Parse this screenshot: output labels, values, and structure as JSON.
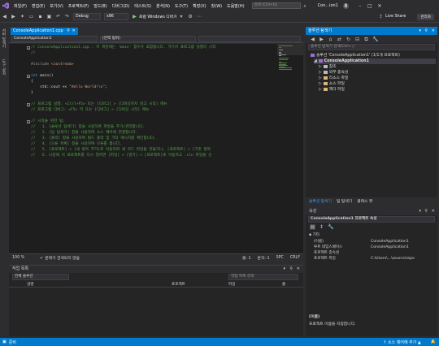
{
  "menu": {
    "items": [
      "파일(F)",
      "편집(E)",
      "보기(V)",
      "프로젝트(P)",
      "빌드(B)",
      "디버그(D)",
      "테스트(S)",
      "분석(N)",
      "도구(T)",
      "확장(X)",
      "창(W)",
      "도움말(H)"
    ],
    "search_placeholder": "검색 (Ctrl+Q)",
    "title_text": "Con...ion1",
    "user_initial": "8"
  },
  "toolbar": {
    "config": "Debug",
    "platform": "x86",
    "run_label": "로컬 Windows 디버거",
    "live_share": "Live Share",
    "admin": "관리자"
  },
  "left_strip": {
    "labels": [
      "서버 탐색기",
      "도구 상자"
    ]
  },
  "editor": {
    "tab_label": "ConsoleApplication1.cpp",
    "nav_project": "ConsoleApplication1",
    "nav_scope": "(전역 범위)",
    "lines": [
      "// ConsoleApplication1.cpp : 이 파일에는 'main' 함수가 포함됩니다. 거기서 프로그램 실행이 시작",
      "//",
      "",
      "#include <iostream>",
      "",
      "int main()",
      "{",
      "    std::cout << \"Hello World!\\n\";",
      "}",
      "",
      "// 프로그램 실행: <Ctrl+F5> 또는 [디버그] > [디버깅하지 않고 시작] 메뉴",
      "// 프로그램 디버그: <F5> 키 또는 [디버그] > [디버깅 시작] 메뉴",
      "",
      "// 시작을 위한 팁:",
      "//   1. [솔루션 탐색기] 창을 사용하여 파일을 추가/관리합니다.",
      "//   2. [팀 탐색기] 창을 사용하여 소스 제어에 연결합니다.",
      "//   3. [출력] 창을 사용하여 빌드 출력 및 기타 메시지를 확인합니다.",
      "//   4. [오류 목록] 창을 사용하여 오류를 봅니다.",
      "//   5. [프로젝트] > [새 항목 추가]로 이동하여 새 코드 파일을 만들거나, [프로젝트] > [기존 항목",
      "//   6. 나중에 이 프로젝트를 다시 열려면 [파일] > [열기] > [프로젝트]로 이동하고 .sln 파일을 선"
    ],
    "status_zoom": "100 %",
    "status_issues": "문제가 검색되지 않음",
    "status_line": "줄: 1",
    "status_col": "문자: 1",
    "status_mode": "SPC",
    "status_eol": "CRLF"
  },
  "error_list": {
    "title": "작업 목록",
    "scope": "전체 솔루션",
    "search_placeholder": "작업 목록 검색",
    "columns": [
      "설명",
      "프로젝트",
      "파일",
      "줄"
    ]
  },
  "solution_explorer": {
    "title": "솔루션 탐색기",
    "search_placeholder": "솔루션 탐색기 검색(Ctrl+;)",
    "items": [
      {
        "label": "솔루션 'ConsoleApplication1' (1/1개 프로젝트)",
        "level": 0,
        "bold": false
      },
      {
        "label": "ConsoleApplication1",
        "level": 1,
        "bold": true
      },
      {
        "label": "참조",
        "level": 2,
        "bold": false
      },
      {
        "label": "외부 종속성",
        "level": 2,
        "bold": false
      },
      {
        "label": "리소스 파일",
        "level": 2,
        "bold": false
      },
      {
        "label": "소스 파일",
        "level": 2,
        "bold": false
      },
      {
        "label": "헤더 파일",
        "level": 2,
        "bold": false
      }
    ],
    "tabs": [
      "솔루션 탐색기",
      "팀 탐색기",
      "클래스 뷰"
    ]
  },
  "properties": {
    "title": "속성",
    "object": "ConsoleApplication1 프로젝트 속성",
    "category": "기타",
    "rows": [
      {
        "key": "(이름)",
        "value": "ConsoleApplication1"
      },
      {
        "key": "루트 네임스페이스",
        "value": "ConsoleApplication1"
      },
      {
        "key": "프로젝트 종속성",
        "value": ""
      },
      {
        "key": "프로젝트 파일",
        "value": "C:\\Users\\...\\source\\repo"
      }
    ],
    "desc_title": "(이름)",
    "desc_text": "프로젝트 이름을 지정합니다."
  },
  "statusbar": {
    "ready": "준비",
    "source_control": "↑ 소스 제어에 추가 ▲"
  },
  "colors": {
    "accent": "#007acc",
    "comment": "#57a64a",
    "keyword": "#569cd6",
    "string": "#d69d85",
    "preprocessor": "#9b9b9b"
  }
}
